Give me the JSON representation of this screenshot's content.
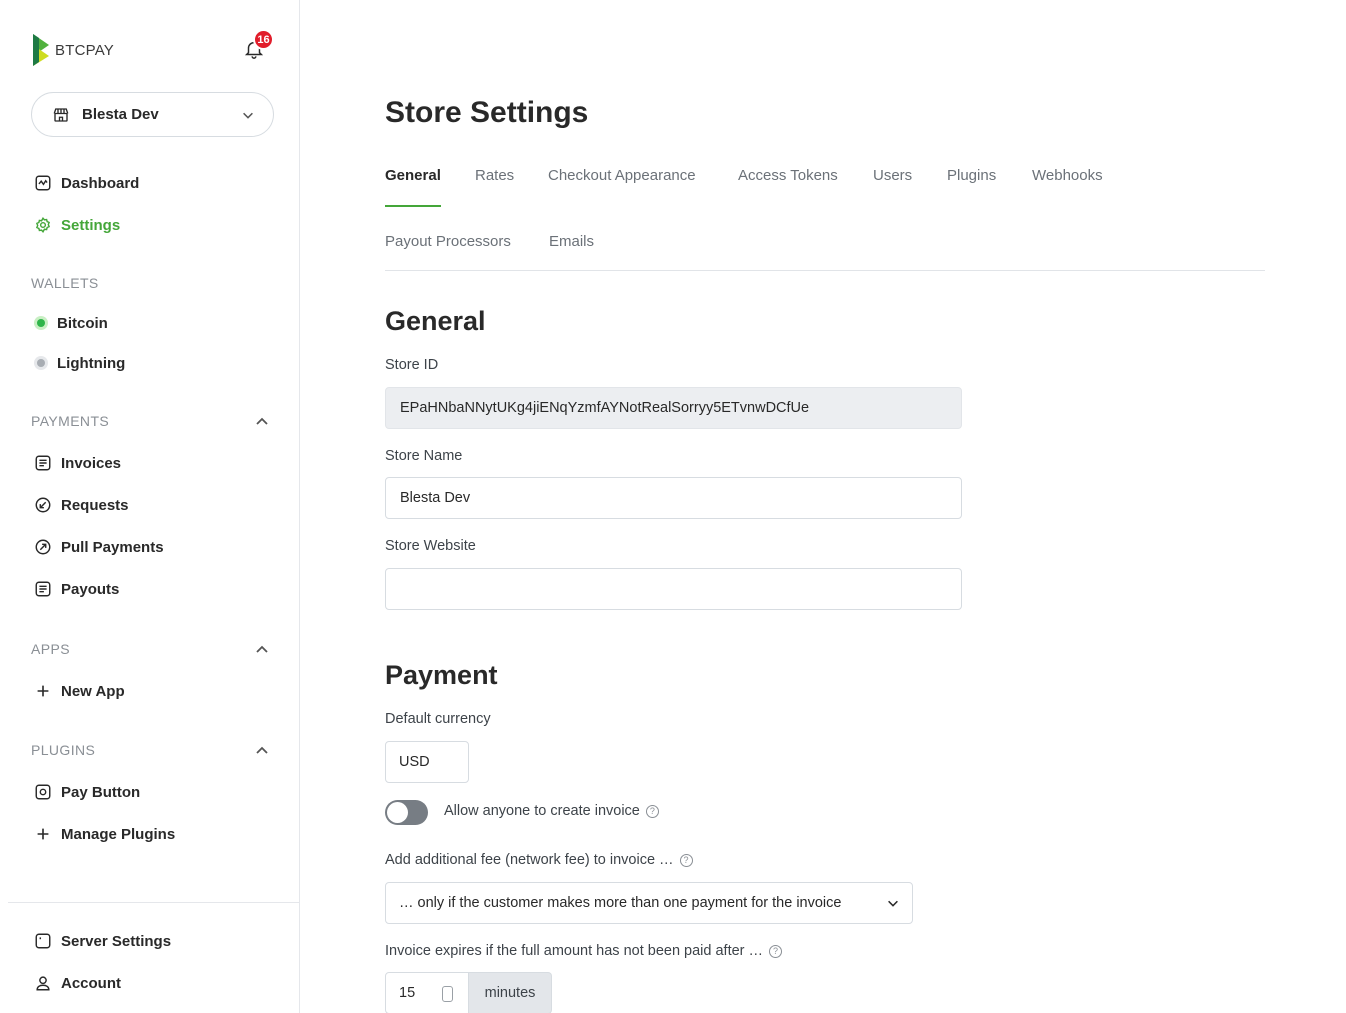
{
  "brand": {
    "name": "BTCPAY",
    "notification_count": "16",
    "accent": "#44a639"
  },
  "store_selector": {
    "label": "Blesta Dev"
  },
  "nav": {
    "dashboard": "Dashboard",
    "settings": "Settings",
    "wallets_title": "WALLETS",
    "bitcoin": "Bitcoin",
    "lightning": "Lightning",
    "payments_title": "PAYMENTS",
    "invoices": "Invoices",
    "requests": "Requests",
    "pull_payments": "Pull Payments",
    "payouts": "Payouts",
    "apps_title": "APPS",
    "new_app": "New App",
    "plugins_title": "PLUGINS",
    "pay_button": "Pay Button",
    "manage_plugins": "Manage Plugins",
    "server_settings": "Server Settings",
    "account": "Account"
  },
  "page": {
    "title": "Store Settings",
    "tabs": [
      "General",
      "Rates",
      "Checkout Appearance",
      "Access Tokens",
      "Users",
      "Plugins",
      "Webhooks",
      "Payout Processors",
      "Emails"
    ],
    "active_tab": "General"
  },
  "general": {
    "heading": "General",
    "store_id_label": "Store ID",
    "store_id_value": "EPaHNbaNNytUKg4jiENqYzmfAYNotRealSorryy5ETvnwDCfUe",
    "store_name_label": "Store Name",
    "store_name_value": "Blesta Dev",
    "store_website_label": "Store Website",
    "store_website_value": ""
  },
  "payment": {
    "heading": "Payment",
    "default_currency_label": "Default currency",
    "default_currency_value": "USD",
    "allow_anyone_label": "Allow anyone to create invoice",
    "allow_anyone_enabled": false,
    "network_fee_label": "Add additional fee (network fee) to invoice …",
    "network_fee_value": "… only if the customer makes more than one payment for the invoice",
    "expiry_label": "Invoice expires if the full amount has not been paid after …",
    "expiry_value": "15",
    "expiry_unit": "minutes"
  }
}
